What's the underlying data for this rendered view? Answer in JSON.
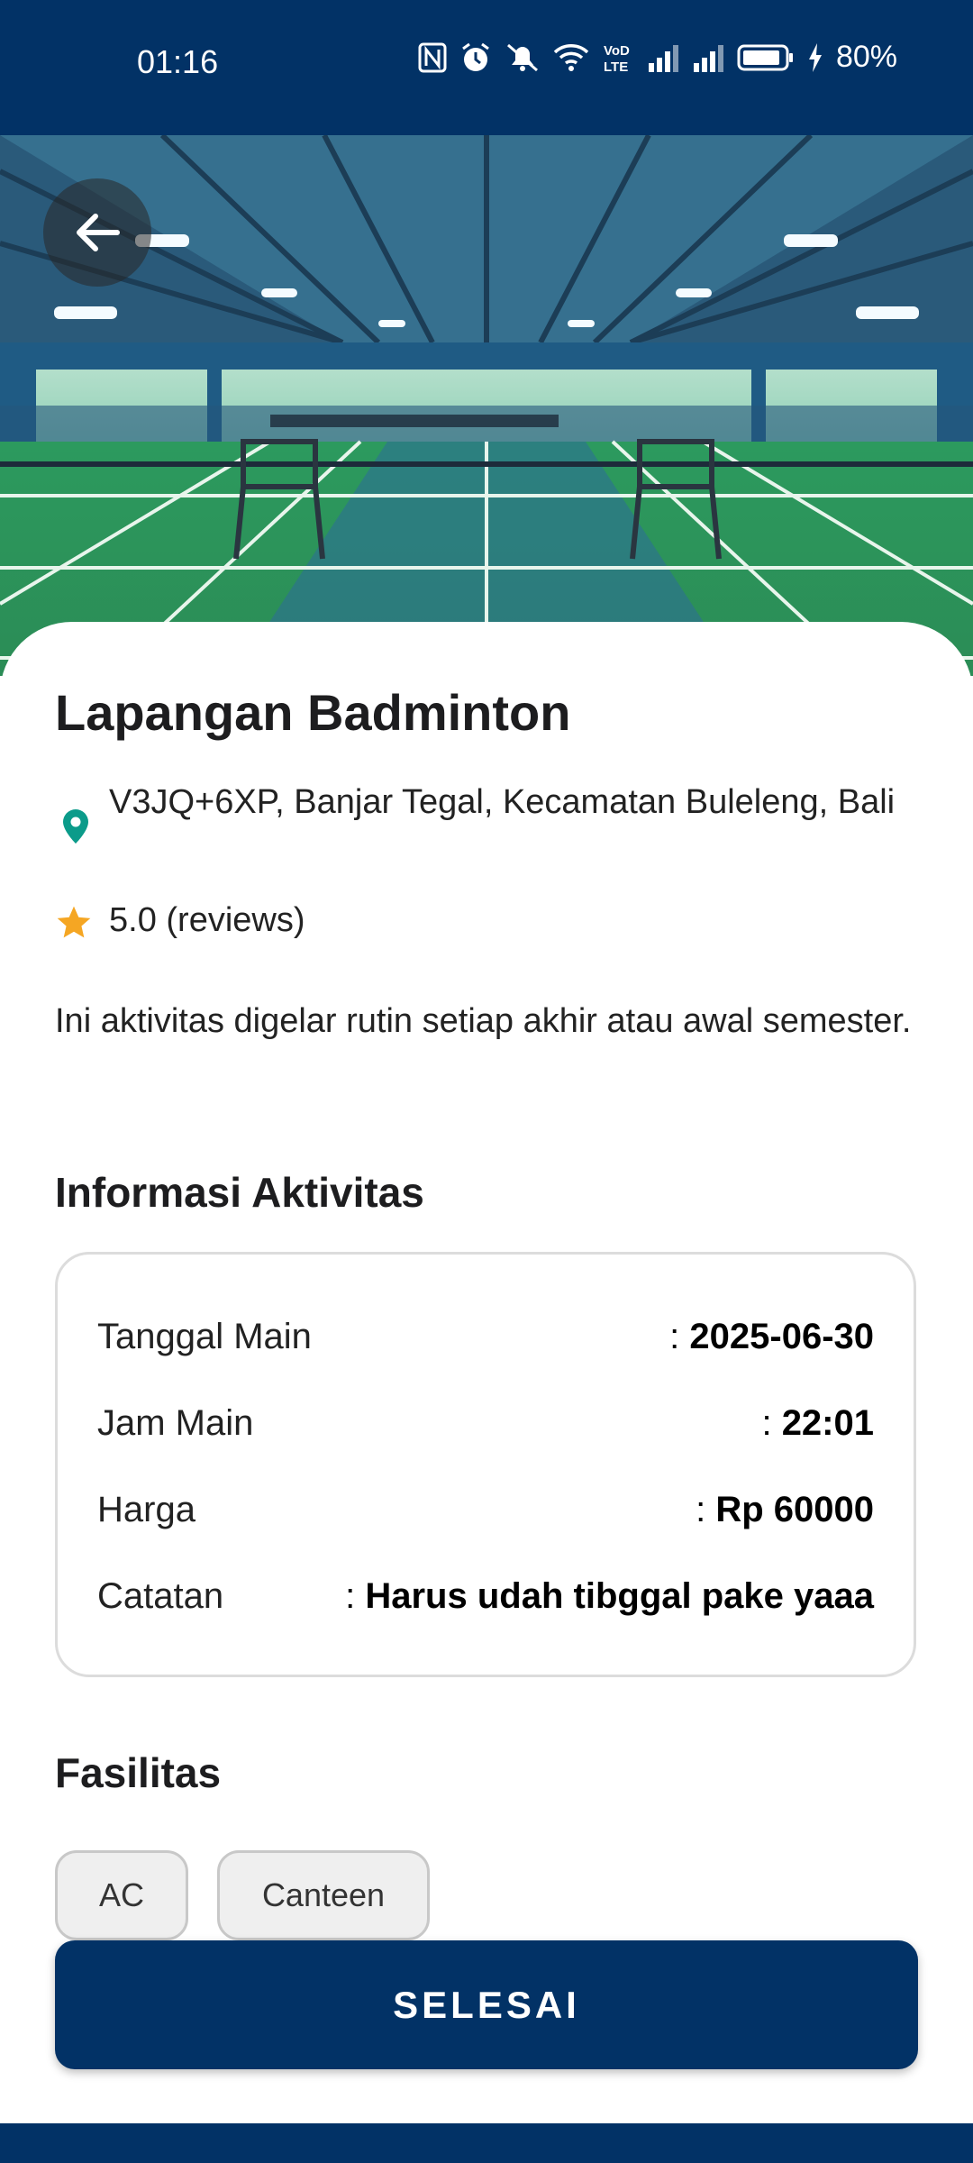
{
  "status_bar": {
    "time": "01:16",
    "battery": "80%",
    "icons": [
      "nfc-icon",
      "alarm-icon",
      "mute-icon",
      "wifi-icon",
      "volte-icon",
      "signal-icon",
      "signal-icon",
      "battery-icon",
      "charging-icon"
    ]
  },
  "colors": {
    "primary": "#023266",
    "location": "#0b9b8a",
    "star": "#f5a623"
  },
  "venue": {
    "title": "Lapangan Badminton",
    "address": "V3JQ+6XP, Banjar Tegal, Kecamatan Buleleng, Bali",
    "rating": "5.0 (reviews)",
    "description": "Ini aktivitas digelar rutin setiap akhir atau awal semester."
  },
  "info": {
    "heading": "Informasi Aktivitas",
    "rows": [
      {
        "label": "Tanggal Main",
        "value": "2025-06-30"
      },
      {
        "label": "Jam Main",
        "value": "22:01"
      },
      {
        "label": "Harga",
        "value": "Rp 60000"
      },
      {
        "label": "Catatan",
        "value": "Harus udah tibggal pake yaaa"
      }
    ]
  },
  "facilities": {
    "heading": "Fasilitas",
    "items": [
      "AC",
      "Canteen"
    ]
  },
  "action": {
    "label": "SELESAI"
  }
}
